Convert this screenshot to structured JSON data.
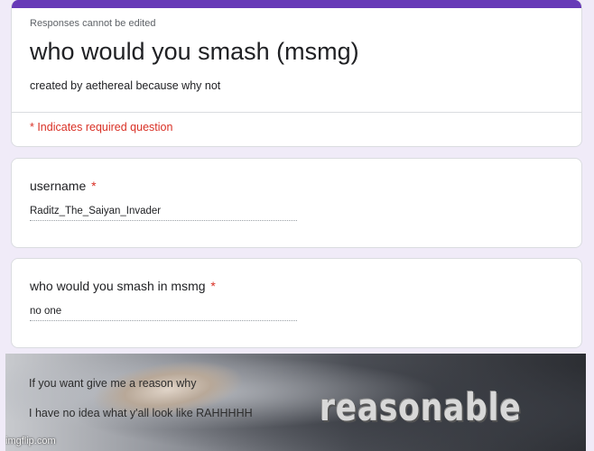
{
  "form": {
    "notice": "Responses cannot be edited",
    "title": "who would you smash (msmg)",
    "description": "created by aethereal because why not",
    "required_note": "* Indicates required question"
  },
  "questions": [
    {
      "label": "username",
      "required_mark": "*",
      "answer": "Raditz_The_Saiyan_Invader"
    },
    {
      "label": "who would you smash in msmg",
      "required_mark": "*",
      "answer": "no one"
    }
  ],
  "meme": {
    "line1": "If you want give me a reason why",
    "line2": "I have no idea what y'all look like RAHHHHH",
    "caption": "reasonable",
    "watermark": "imgflip.com"
  },
  "colors": {
    "accent": "#673ab7",
    "background": "#f0ebf8",
    "required": "#d93025"
  }
}
